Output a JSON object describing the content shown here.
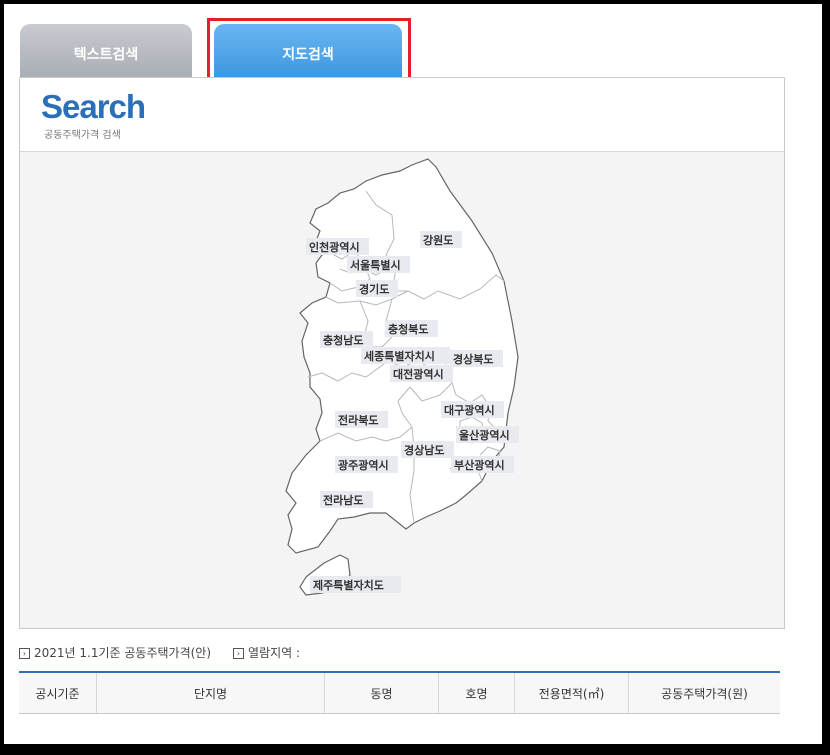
{
  "tabs": [
    {
      "label": "텍스트검색"
    },
    {
      "label": "지도검색"
    }
  ],
  "header": {
    "logo": "Search",
    "subtitle": "공동주택가격 검색"
  },
  "regions": [
    "인천광역시",
    "서울특별시",
    "강원도",
    "경기도",
    "충청북도",
    "충청남도",
    "세종특별자치시",
    "경상북도",
    "대전광역시",
    "대구광역시",
    "전라북도",
    "울산광역시",
    "경상남도",
    "광주광역시",
    "부산광역시",
    "전라남도",
    "제주특별자치도"
  ],
  "info": {
    "basis": "2021년 1.1기준 공동주택가격(안)",
    "area_label": "열람지역 :"
  },
  "table": {
    "headers": [
      "공시기준",
      "단지명",
      "동명",
      "호명",
      "전용면적(㎡)",
      "공동주택가격(원)"
    ]
  },
  "colors": {
    "active_tab": "#4ea6ea",
    "inactive_tab": "#b6b9be",
    "highlight": "#e0202a",
    "logo": "#2a6fb8"
  }
}
